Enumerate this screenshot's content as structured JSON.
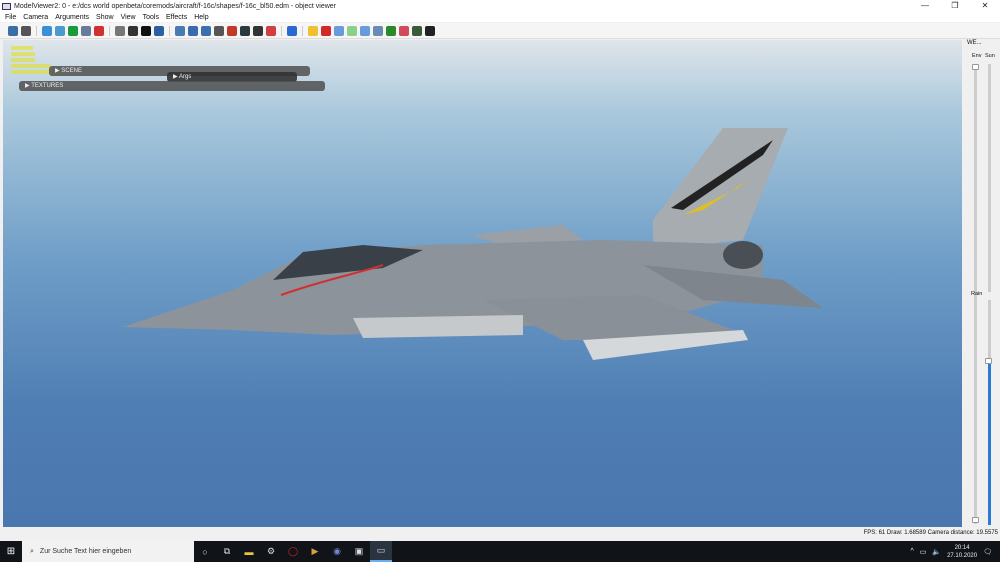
{
  "window": {
    "title": "ModelViewer2: 0 - e:/dcs world openbeta/coremods/aircraft/f-16c/shapes/f-16c_bl50.edm - object viewer",
    "minimize": "—",
    "maximize": "❐",
    "close": "✕"
  },
  "menu": [
    "File",
    "Camera",
    "Arguments",
    "Show",
    "View",
    "Tools",
    "Effects",
    "Help"
  ],
  "toolbar_colors": [
    "#3a6ea5",
    "#555",
    "#3b8fd9",
    "#4a9ad0",
    "#1a9a3a",
    "#6a7a9a",
    "#d03030",
    "#777",
    "#333",
    "#111",
    "#2a5fa0",
    "#4a7ab0",
    "#3a6ab0",
    "#3a70b0",
    "#555",
    "#c03a2a",
    "#2a3a40",
    "#333",
    "#d04040",
    "#2a6ad0",
    "#f0c030",
    "#d02a2a",
    "#6a9ad8",
    "#8ad08a",
    "#6a9ad8",
    "#6a8ab8",
    "#2a8a2a",
    "#d04a5a",
    "#3a5a3a",
    "#222"
  ],
  "overlay": {
    "scene": "SCENE",
    "args": "Args",
    "textures": "TEXTURES"
  },
  "side_panel": {
    "title": "WE...",
    "env": "Env",
    "sun": "Sun",
    "rain": "Rain",
    "env_level": 0,
    "sun_level": 0,
    "rain_level": 0.72
  },
  "status": "FPS: 61  Draw: 1.68589  Camera distance: 19.5575",
  "taskbar": {
    "search_placeholder": "Zur Suche Text hier eingeben",
    "time": "20:14",
    "date": "27.10.2020"
  }
}
